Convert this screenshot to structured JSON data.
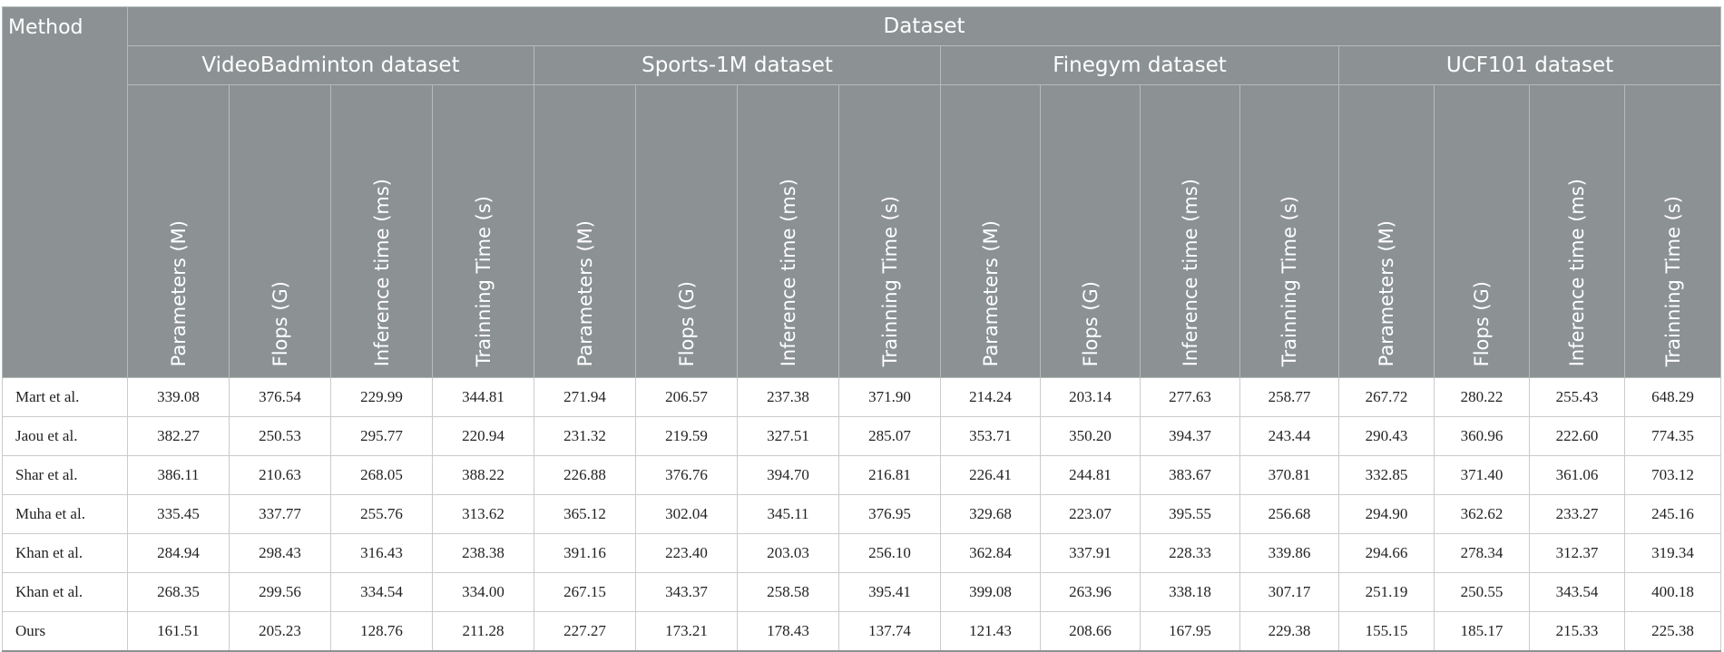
{
  "header": {
    "method": "Method",
    "dataset": "Dataset",
    "groups": [
      "VideoBadminton dataset",
      "Sports-1M dataset",
      "Finegym dataset",
      "UCF101 dataset"
    ],
    "columns": [
      "Parameters (M)",
      "Flops (G)",
      "Inference time (ms)",
      "Trainning Time (s)"
    ]
  },
  "rows": [
    {
      "method": "Mart et al.",
      "values": [
        "339.08",
        "376.54",
        "229.99",
        "344.81",
        "271.94",
        "206.57",
        "237.38",
        "371.90",
        "214.24",
        "203.14",
        "277.63",
        "258.77",
        "267.72",
        "280.22",
        "255.43",
        "648.29"
      ]
    },
    {
      "method": "Jaou et al.",
      "values": [
        "382.27",
        "250.53",
        "295.77",
        "220.94",
        "231.32",
        "219.59",
        "327.51",
        "285.07",
        "353.71",
        "350.20",
        "394.37",
        "243.44",
        "290.43",
        "360.96",
        "222.60",
        "774.35"
      ]
    },
    {
      "method": "Shar et al.",
      "values": [
        "386.11",
        "210.63",
        "268.05",
        "388.22",
        "226.88",
        "376.76",
        "394.70",
        "216.81",
        "226.41",
        "244.81",
        "383.67",
        "370.81",
        "332.85",
        "371.40",
        "361.06",
        "703.12"
      ]
    },
    {
      "method": "Muha et al.",
      "values": [
        "335.45",
        "337.77",
        "255.76",
        "313.62",
        "365.12",
        "302.04",
        "345.11",
        "376.95",
        "329.68",
        "223.07",
        "395.55",
        "256.68",
        "294.90",
        "362.62",
        "233.27",
        "245.16"
      ]
    },
    {
      "method": "Khan et al.",
      "values": [
        "284.94",
        "298.43",
        "316.43",
        "238.38",
        "391.16",
        "223.40",
        "203.03",
        "256.10",
        "362.84",
        "337.91",
        "228.33",
        "339.86",
        "294.66",
        "278.34",
        "312.37",
        "319.34"
      ]
    },
    {
      "method": "Khan et al.",
      "values": [
        "268.35",
        "299.56",
        "334.54",
        "334.00",
        "267.15",
        "343.37",
        "258.58",
        "395.41",
        "399.08",
        "263.96",
        "338.18",
        "307.17",
        "251.19",
        "250.55",
        "343.54",
        "400.18"
      ]
    },
    {
      "method": "Ours",
      "values": [
        "161.51",
        "205.23",
        "128.76",
        "211.28",
        "227.27",
        "173.21",
        "178.43",
        "137.74",
        "121.43",
        "208.66",
        "167.95",
        "229.38",
        "155.15",
        "185.17",
        "215.33",
        "225.38"
      ]
    }
  ]
}
